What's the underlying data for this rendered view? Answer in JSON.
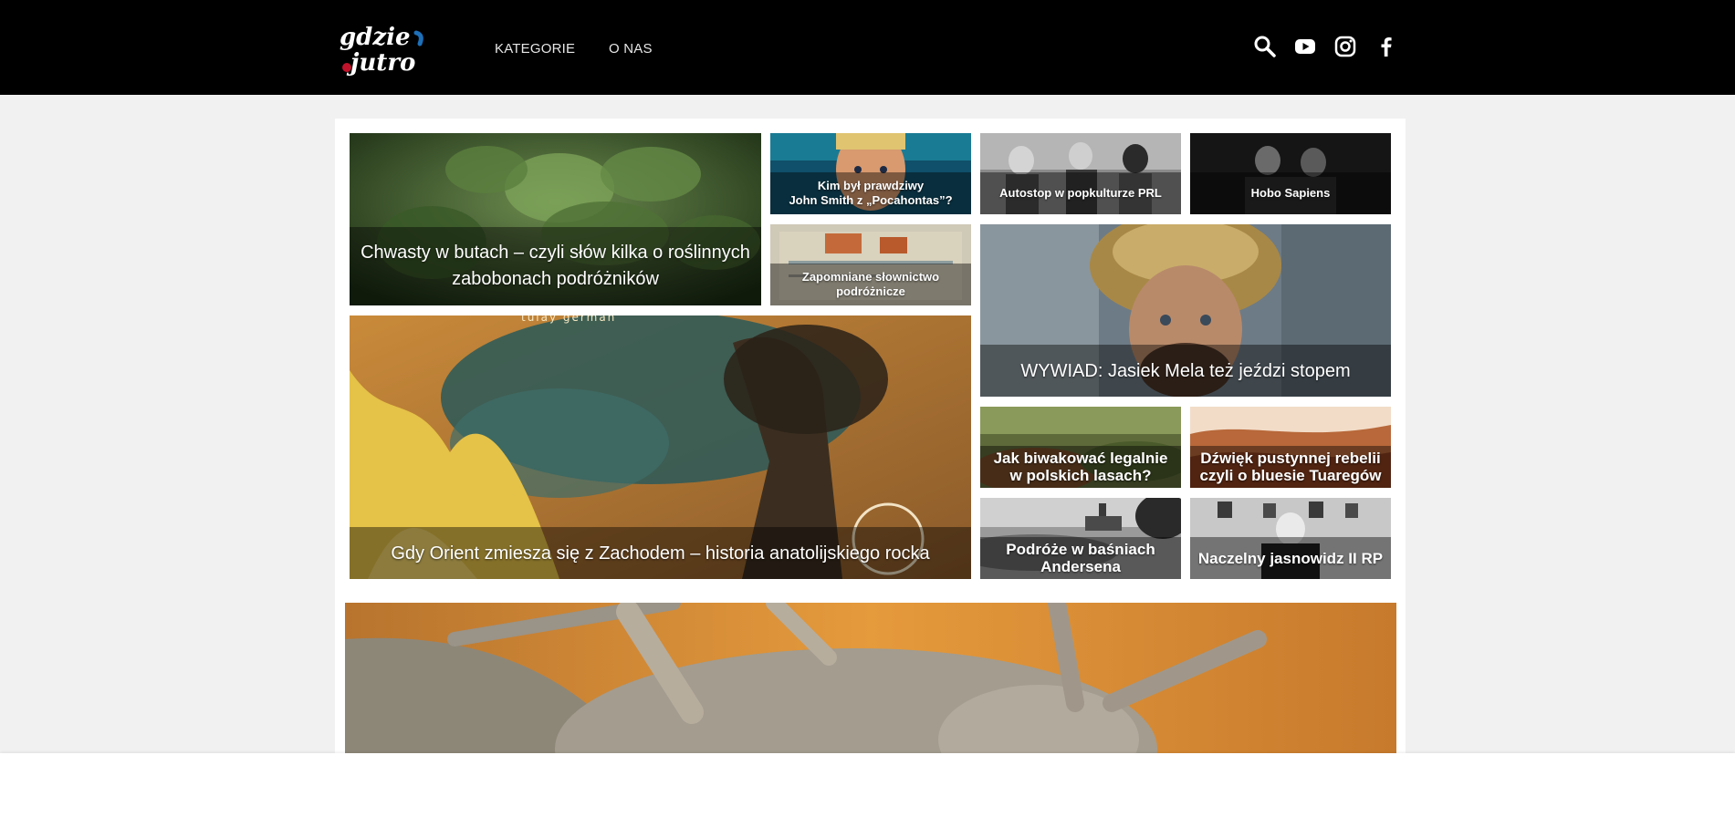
{
  "header": {
    "logo_line1": "gdzie",
    "logo_line2": "jutro",
    "nav": [
      "KATEGORIE",
      "O NAS"
    ],
    "icons": [
      "search-icon",
      "youtube-icon",
      "instagram-icon",
      "facebook-icon"
    ]
  },
  "articles": {
    "chwasty": "Chwasty w butach – czyli słów kilka o roślinnych\nzabobonach podróżników",
    "pocahontas": "Kim był prawdziwy\nJohn Smith z „Pocahontas”?",
    "autostop": "Autostop w popkulturze PRL",
    "hobo": "Hobo Sapiens",
    "slownictwo": "Zapomniane słownictwo\npodróżnicze",
    "wywiad": "WYWIAD: Jasiek Mela też jeździ stopem",
    "orient": "Gdy Orient zmiesza się z Zachodem – historia anatolijskiego rocka",
    "orient_art_text": "tulay german",
    "biwak": "Jak biwakować legalnie\nw polskich lasach?",
    "tuareg": "Dźwięk pustynnej rebelii\nczyli o bluesie Tuaregów",
    "andersen": "Podróże w baśniach\nAndersena",
    "jasnowidz": "Naczelny jasnowidz II RP"
  },
  "colors": {
    "topbar": "#000000",
    "page_bg": "#f1f1f1",
    "caption_overlay": "rgba(0,0,0,0.42)",
    "logo_accent_blue": "#1d6fb8",
    "logo_accent_red": "#c0132b"
  }
}
